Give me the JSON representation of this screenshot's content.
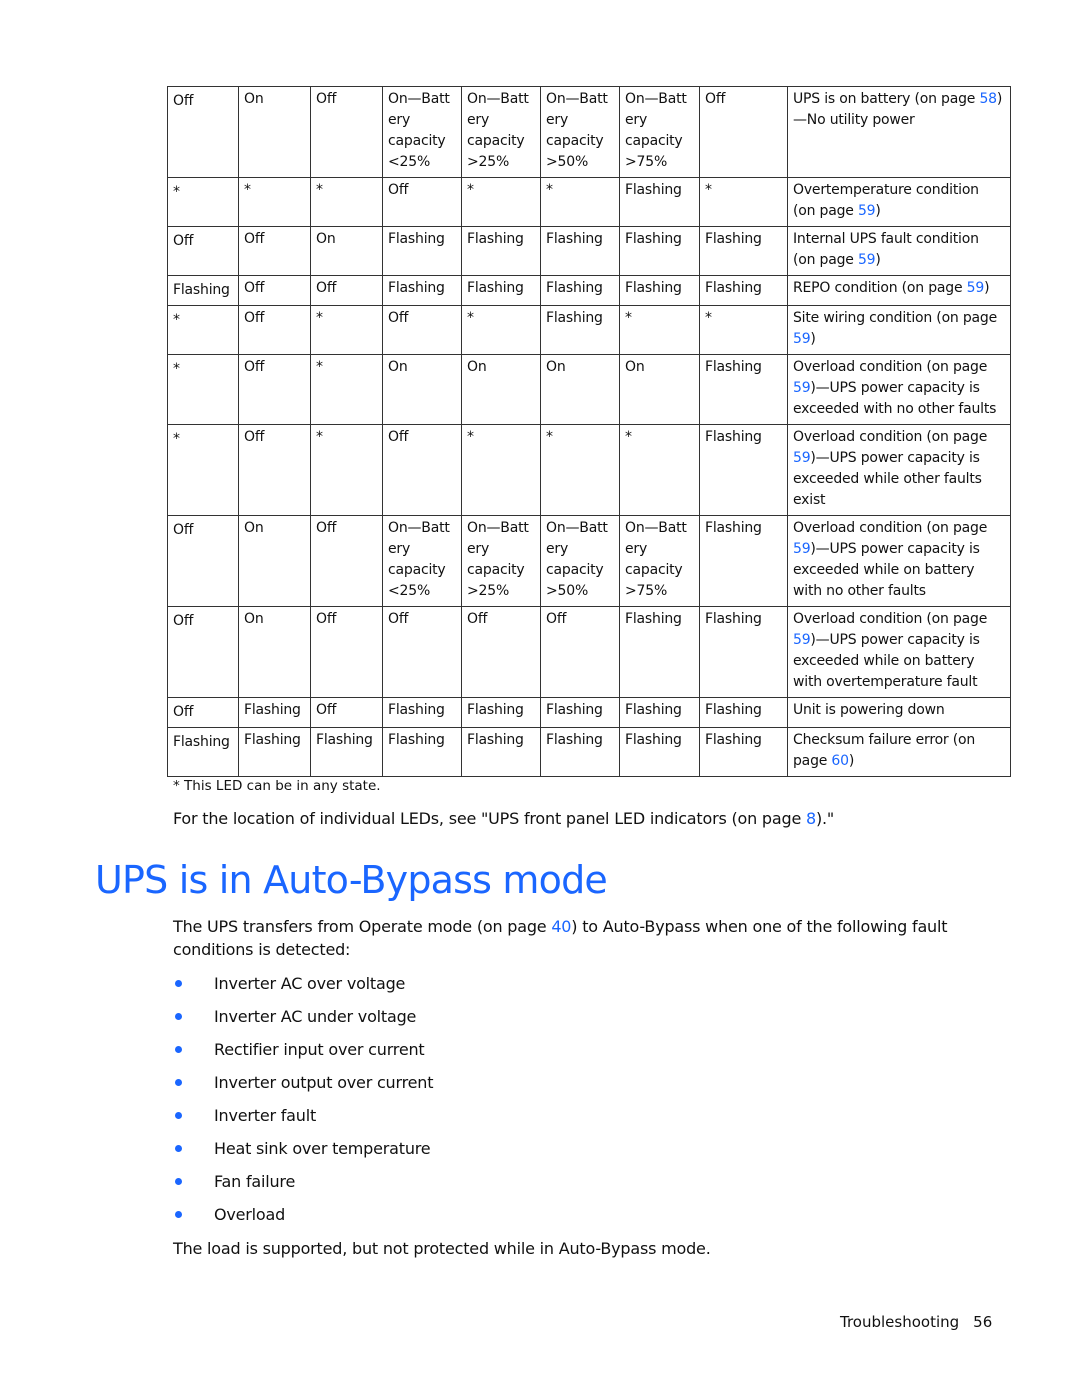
{
  "table": {
    "rows": [
      {
        "cells": [
          "Off",
          "On",
          "Off",
          "On—Batt ery capacity <25%",
          "On—Batt ery capacity >25%",
          "On—Batt ery capacity >50%",
          "On—Batt ery capacity >75%",
          "Off"
        ],
        "condition": {
          "before": "UPS is on battery (on page ",
          "link": "58",
          "after": ")—No utility power"
        }
      },
      {
        "cells": [
          "*",
          "*",
          "*",
          "Off",
          "*",
          "*",
          "Flashing",
          "*"
        ],
        "condition": {
          "before": "Overtemperature condition (on page ",
          "link": "59",
          "after": ")"
        }
      },
      {
        "cells": [
          "Off",
          "Off",
          "On",
          "Flashing",
          "Flashing",
          "Flashing",
          "Flashing",
          "Flashing"
        ],
        "condition": {
          "before": "Internal UPS fault condition (on page ",
          "link": "59",
          "after": ")"
        }
      },
      {
        "cells": [
          "Flashing",
          "Off",
          "Off",
          "Flashing",
          "Flashing",
          "Flashing",
          "Flashing",
          "Flashing"
        ],
        "condition": {
          "before": "REPO condition (on page ",
          "link": "59",
          "after": ")"
        }
      },
      {
        "cells": [
          "*",
          "Off",
          "*",
          "Off",
          "*",
          "Flashing",
          "*",
          "*"
        ],
        "condition": {
          "before": "Site wiring condition (on page ",
          "link": "59",
          "after": ")"
        }
      },
      {
        "cells": [
          "*",
          "Off",
          "*",
          "On",
          "On",
          "On",
          "On",
          "Flashing"
        ],
        "condition": {
          "before": "Overload condition (on page ",
          "link": "59",
          "after": ")—UPS power capacity is exceeded with no other faults"
        }
      },
      {
        "cells": [
          "*",
          "Off",
          "*",
          "Off",
          "*",
          "*",
          "*",
          "Flashing"
        ],
        "condition": {
          "before": "Overload condition (on page ",
          "link": "59",
          "after": ")—UPS power capacity is exceeded while other faults exist"
        }
      },
      {
        "cells": [
          "Off",
          "On",
          "Off",
          "On—Batt ery capacity <25%",
          "On—Batt ery capacity >25%",
          "On—Batt ery capacity >50%",
          "On—Batt ery capacity >75%",
          "Flashing"
        ],
        "condition": {
          "before": "Overload condition (on page ",
          "link": "59",
          "after": ")—UPS power capacity is exceeded while on battery with no other faults"
        }
      },
      {
        "cells": [
          "Off",
          "On",
          "Off",
          "Off",
          "Off",
          "Off",
          "Flashing",
          "Flashing"
        ],
        "condition": {
          "before": "Overload condition (on page ",
          "link": "59",
          "after": ")—UPS power capacity is exceeded while on battery with overtemperature fault"
        }
      },
      {
        "cells": [
          "Off",
          "Flashing",
          "Off",
          "Flashing",
          "Flashing",
          "Flashing",
          "Flashing",
          "Flashing"
        ],
        "condition": {
          "before": "Unit is powering down",
          "link": "",
          "after": ""
        }
      },
      {
        "cells": [
          "Flashing",
          "Flashing",
          "Flashing",
          "Flashing",
          "Flashing",
          "Flashing",
          "Flashing",
          "Flashing"
        ],
        "condition": {
          "before": "Checksum failure error (on page ",
          "link": "60",
          "after": ")"
        }
      }
    ]
  },
  "footnote": "* This LED can be in any state.",
  "location_note": {
    "before": "For the location of individual LEDs, see \"UPS front panel LED indicators (on page ",
    "link": "8",
    "after": ").\""
  },
  "section": {
    "title": "UPS is in Auto-Bypass mode",
    "intro": {
      "before": "The UPS transfers from Operate mode (on page ",
      "link": "40",
      "after": ") to Auto-Bypass when one of the following fault conditions is detected:"
    },
    "bullets": [
      "Inverter AC over voltage",
      "Inverter AC under voltage",
      "Rectifier input over current",
      "Inverter output over current",
      "Inverter fault",
      "Heat sink over temperature",
      "Fan failure",
      "Overload"
    ],
    "closing": "The load is supported, but not protected while in Auto-Bypass mode."
  },
  "footer": {
    "section": "Troubleshooting",
    "page": "56"
  },
  "colors": {
    "link": "#1a66ff",
    "heading": "#1a66ff",
    "text": "#111111",
    "border": "#333333"
  }
}
